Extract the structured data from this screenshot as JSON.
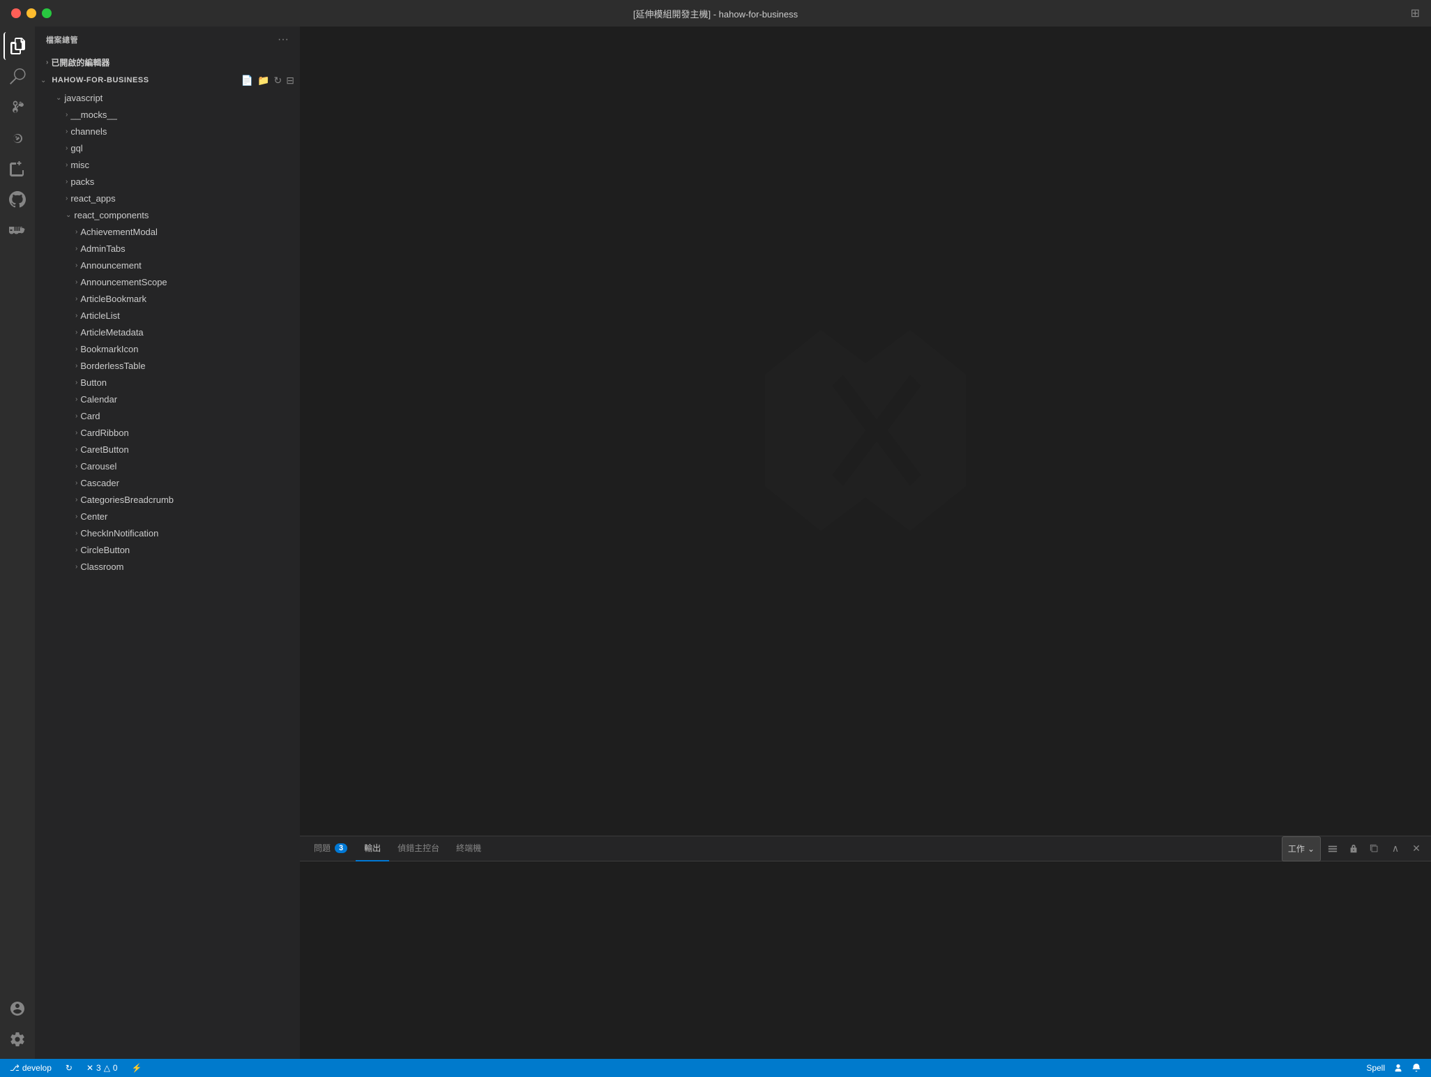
{
  "titlebar": {
    "title": "[延伸模組開發主機] - hahow-for-business",
    "buttons": {
      "close": "close",
      "minimize": "minimize",
      "maximize": "maximize"
    }
  },
  "sidebar": {
    "header": "檔案總管",
    "opened_editors_label": "已開啟的編輯器",
    "project_name": "HAHOW-FOR-BUSINESS",
    "tree": {
      "javascript": {
        "label": "javascript",
        "children": {
          "__mocks__": "__mocks__",
          "channels": "channels",
          "gql": "gql",
          "misc": "misc",
          "packs": "packs",
          "react_apps": "react_apps",
          "react_components": {
            "label": "react_components",
            "children": [
              "AchievementModal",
              "AdminTabs",
              "Announcement",
              "AnnouncementScope",
              "ArticleBookmark",
              "ArticleList",
              "ArticleMetadata",
              "BookmarkIcon",
              "BorderlessTable",
              "Button",
              "Calendar",
              "Card",
              "CardRibbon",
              "CaretButton",
              "Carousel",
              "Cascader",
              "CategoriesBreadcrumb",
              "Center",
              "CheckInNotification",
              "CircleButton",
              "Classroom"
            ]
          }
        }
      }
    }
  },
  "panel": {
    "tabs": [
      {
        "label": "問題",
        "badge": "3",
        "active": false
      },
      {
        "label": "輸出",
        "badge": null,
        "active": true
      },
      {
        "label": "偵錯主控台",
        "badge": null,
        "active": false
      },
      {
        "label": "終端機",
        "badge": null,
        "active": false
      }
    ],
    "dropdown_label": "工作"
  },
  "statusbar": {
    "branch_icon": "⎇",
    "branch_name": "develop",
    "sync_icon": "↻",
    "errors_icon": "✕",
    "errors_count": "3",
    "warnings_icon": "△",
    "warnings_count": "0",
    "lightning_icon": "⚡",
    "right_spell": "Spell",
    "right_persons_icon": "👥",
    "right_bell_icon": "🔔"
  }
}
